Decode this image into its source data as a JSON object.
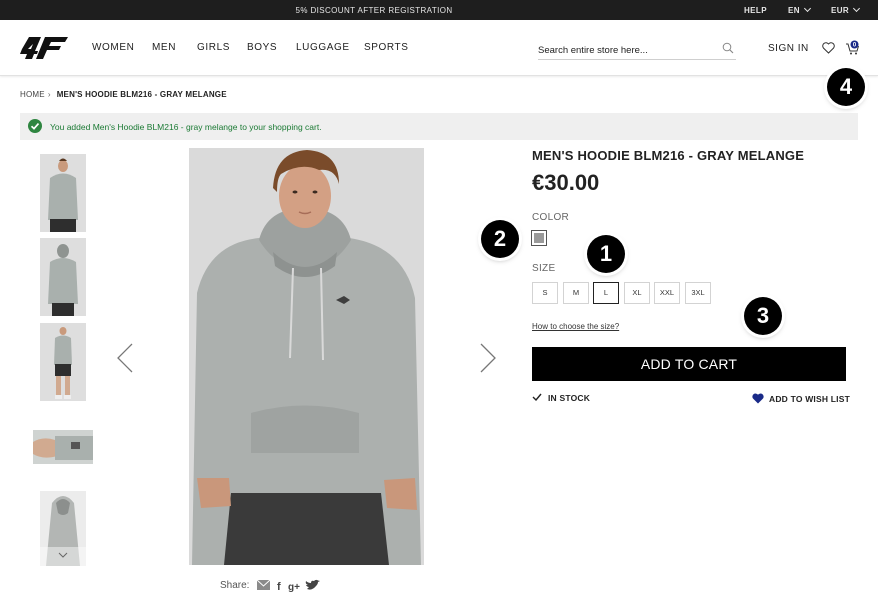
{
  "topbar": {
    "promo": "5% DISCOUNT AFTER REGISTRATION",
    "help": "HELP",
    "language": "EN",
    "currency": "EUR"
  },
  "header": {
    "logo_text": "4F",
    "nav": [
      "WOMEN",
      "MEN",
      "GIRLS",
      "BOYS",
      "LUGGAGE",
      "SPORTS"
    ],
    "search_placeholder": "Search entire store here...",
    "signin": "SIGN IN",
    "cart_count": "0"
  },
  "breadcrumb": {
    "home": "HOME",
    "current": "MEN'S HOODIE BLM216 - GRAY MELANGE"
  },
  "message": {
    "text": "You added Men's Hoodie BLM216 - gray melange to your shopping cart.",
    "color": "#2e8540"
  },
  "product": {
    "title": "MEN'S HOODIE BLM216 - GRAY MELANGE",
    "price": "€30.00",
    "color_label": "COLOR",
    "color_swatch": "#9a9a9a",
    "size_label": "SIZE",
    "sizes": [
      "S",
      "M",
      "L",
      "XL",
      "XXL",
      "3XL"
    ],
    "selected_size": "L",
    "size_guide": "How to choose the size?",
    "add_to_cart": "ADD TO CART",
    "stock": "IN STOCK",
    "wishlist": "ADD TO WISH LIST"
  },
  "share_label": "Share:",
  "badges": [
    "1",
    "2",
    "3",
    "4"
  ]
}
